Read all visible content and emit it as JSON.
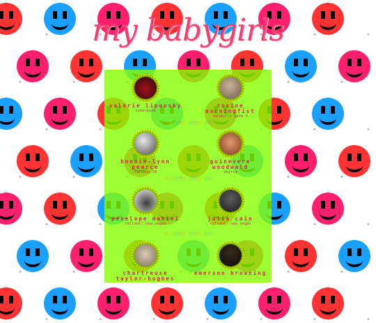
{
  "page": {
    "title": "my babygirls",
    "colors": {
      "title": "#ef3f6f",
      "panel": "#84ff00",
      "name_text": "#e2185d",
      "smiley_colors": [
        "#ff3333",
        "#ff8c1a",
        "#1aa0ff",
        "#22dd22",
        "#ff1f6f",
        "#ffd400"
      ]
    }
  },
  "divider": {
    "icon": "rainbow-hearts-icon",
    "glyph": "♡"
  },
  "cards": [
    {
      "name": "valerie lipovsky",
      "subtitle": "cyberpunk",
      "avatar_icon": "avatar-red-dark-icon",
      "avatar_colors": [
        "#2a0a0e",
        "#a0111b"
      ]
    },
    {
      "name": "rosine morningfist",
      "subtitle": "baldur's gate 3",
      "avatar_icon": "avatar-tan-icon",
      "avatar_colors": [
        "#c9b49a",
        "#6a5a4a"
      ]
    },
    {
      "name": "bonnie-lynn pearce",
      "subtitle": "fallout 76",
      "avatar_icon": "avatar-grey-icon",
      "avatar_colors": [
        "#e8e8e8",
        "#4a4a4a"
      ]
    },
    {
      "name": "guinevere woodwald",
      "subtitle": "skyrim",
      "avatar_icon": "avatar-warm-icon",
      "avatar_colors": [
        "#e49a6a",
        "#7b3a24"
      ]
    },
    {
      "name": "penelope mahini",
      "subtitle": "fallout: new vegas",
      "avatar_icon": "avatar-snow-icon",
      "avatar_colors": [
        "#f4f4f4",
        "#3a3a3a"
      ]
    },
    {
      "name": "julia cain",
      "subtitle": "fallout: new vegas",
      "avatar_icon": "avatar-dark-icon",
      "avatar_colors": [
        "#5c5c5c",
        "#1c1c1c"
      ]
    },
    {
      "name": "chartreuse taylor-hughes",
      "subtitle": "",
      "avatar_icon": "avatar-street-icon",
      "avatar_colors": [
        "#d8cbb6",
        "#7b6b55"
      ]
    },
    {
      "name": "emerson browning",
      "subtitle": "",
      "avatar_icon": "avatar-night-icon",
      "avatar_colors": [
        "#3a2a1a",
        "#0e0a08"
      ]
    }
  ]
}
